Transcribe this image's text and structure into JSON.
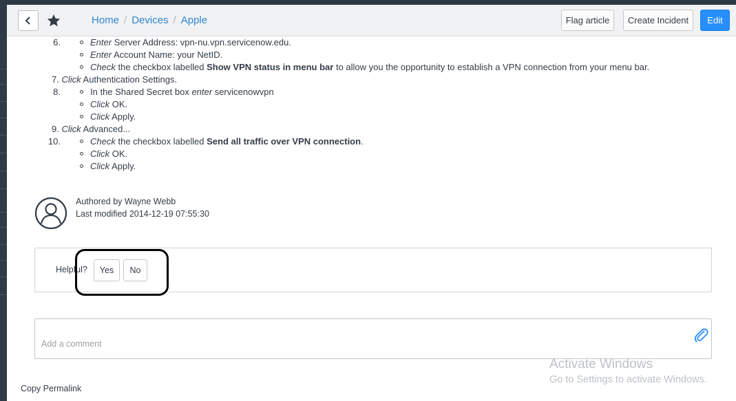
{
  "breadcrumbs": [
    "Home",
    "Devices",
    "Apple"
  ],
  "breadcrumb_separator": "/",
  "header": {
    "flag_label": "Flag article",
    "incident_label": "Create Incident",
    "edit_label": "Edit"
  },
  "icons": {
    "back": "chevron-left-icon",
    "favorite": "star-icon",
    "avatar": "user-avatar-icon",
    "attach": "paperclip-icon"
  },
  "colors": {
    "accent": "#278efc",
    "link": "#2e86cf"
  },
  "article": {
    "item6_num": "6.",
    "item6_b1_verb": "Enter",
    "item6_b1_rest": " Server Address: vpn-nu.vpn.servicenow.edu.",
    "item6_b2_verb": "Enter",
    "item6_b2_rest": " Account Name: your NetID.",
    "item6_b3_verb": "Check",
    "item6_b3_mid": " the checkbox labelled ",
    "item6_b3_bold": "Show VPN status in menu bar",
    "item6_b3_rest": " to allow you the opportunity to establish a VPN connection from your menu bar.",
    "item7_text_verb": "Click",
    "item7_text_rest": " Authentication Settings.",
    "item7_num": "7.",
    "item8_num": "8.",
    "item8_b1_pre": "In the Shared Secret box ",
    "item8_b1_verb": "enter",
    "item8_b1_rest": " servicenowvpn",
    "item8_b2_verb": "Click",
    "item8_b2_rest": " OK.",
    "item8_b3_verb": "Click",
    "item8_b3_rest": " Apply.",
    "item9_num": "9.",
    "item9_verb": "Click",
    "item9_rest": " Advanced...",
    "item10_num": "10.",
    "item10_b1_verb": "Check",
    "item10_b1_mid": " the checkbox labelled ",
    "item10_b1_bold": "Send all traffic over VPN connection",
    "item10_b1_rest": ".",
    "item10_b2_verb": "Click",
    "item10_b2_rest": " OK.",
    "item10_b3_verb": "Click",
    "item10_b3_rest": " Apply."
  },
  "author": {
    "authored": "Authored by Wayne Webb",
    "modified": "Last modified 2014-12-19 07:55:30"
  },
  "feedback": {
    "label": "Helpful?",
    "yes": "Yes",
    "no": "No"
  },
  "comment": {
    "placeholder": "Add a comment"
  },
  "footer": {
    "permalink": "Copy Permalink"
  },
  "watermark": {
    "line1": "Activate Windows",
    "line2": "Go to Settings to activate Windows."
  }
}
